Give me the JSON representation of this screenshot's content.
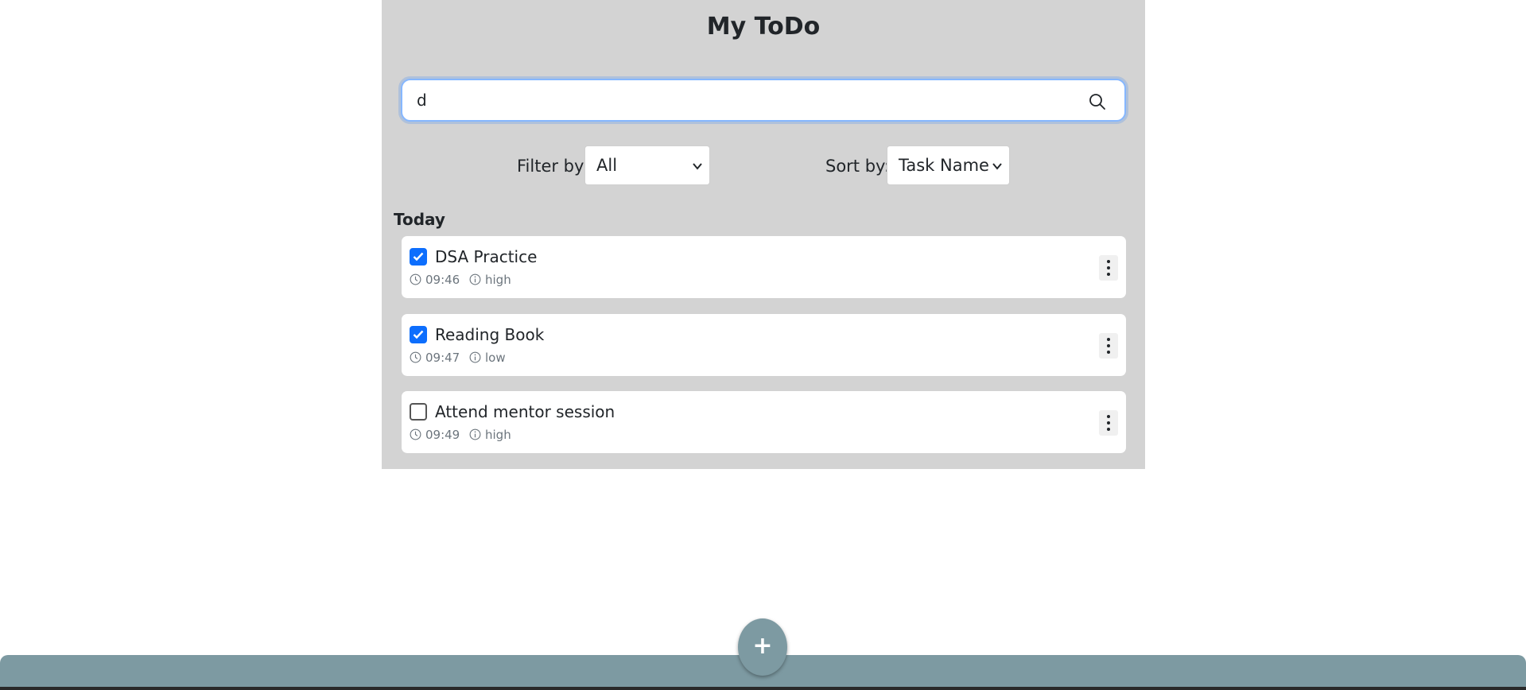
{
  "app": {
    "title": "My ToDo"
  },
  "search": {
    "value": "d",
    "icon": "search-icon"
  },
  "filter": {
    "label": "Filter by:",
    "selected": "All"
  },
  "sort": {
    "label": "Sort by:",
    "selected": "Task Name"
  },
  "section": {
    "title": "Today"
  },
  "tasks": [
    {
      "name": "DSA Practice",
      "time": "09:46",
      "priority": "high",
      "completed": true
    },
    {
      "name": "Reading Book",
      "time": "09:47",
      "priority": "low",
      "completed": true
    },
    {
      "name": "Attend mentor session",
      "time": "09:49",
      "priority": "high",
      "completed": false
    }
  ],
  "fab": {
    "label": "+"
  },
  "colors": {
    "panel": "#d3d3d3",
    "accent": "#7d9aa2",
    "checkbox": "#0d6efd"
  }
}
